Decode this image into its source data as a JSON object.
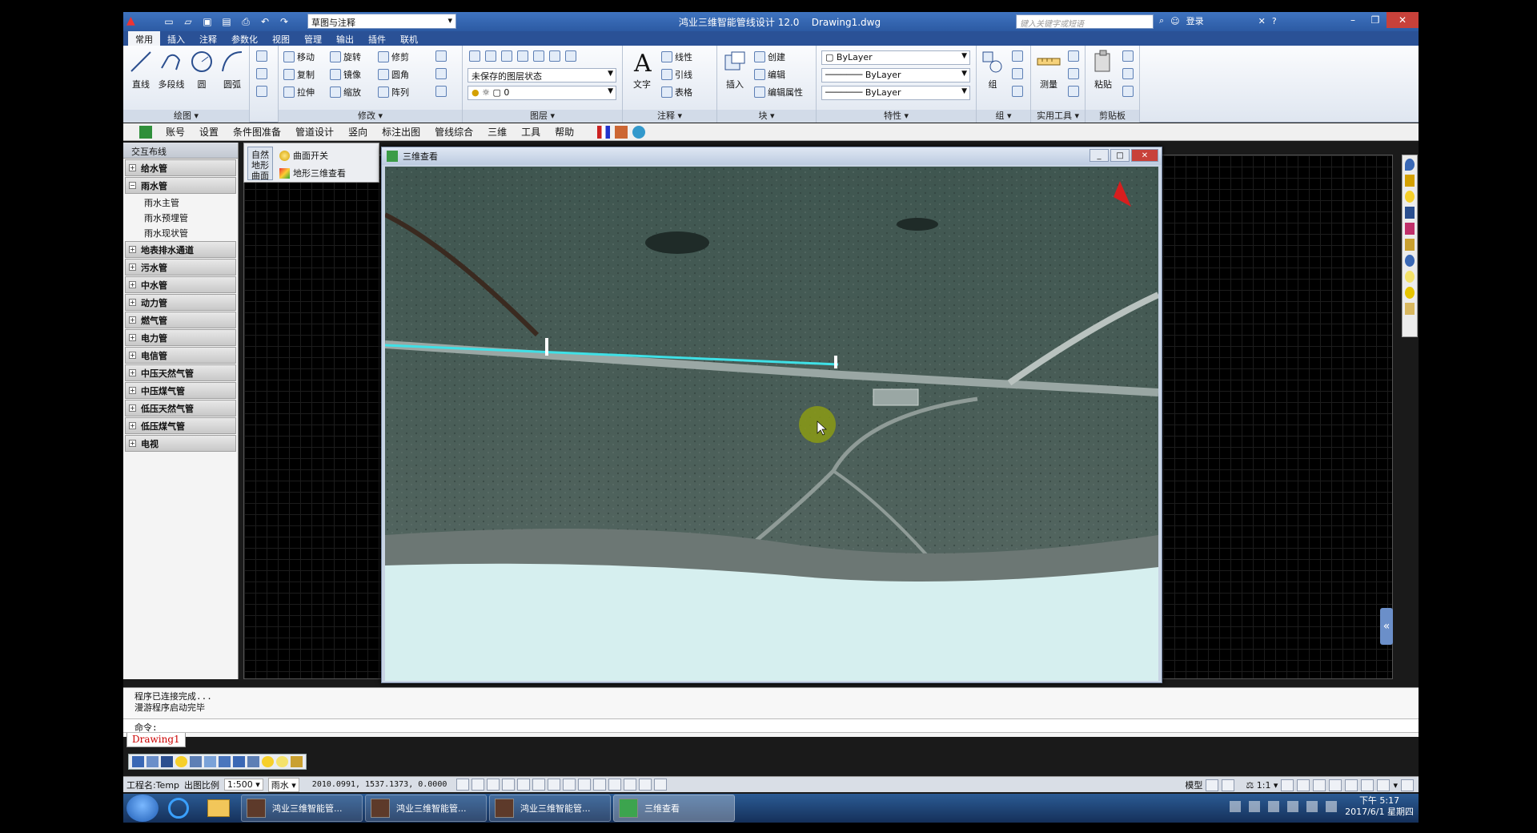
{
  "title_bar": {
    "app_title": "鸿业三维智能管线设计 12.0",
    "doc_name": "Drawing1.dwg",
    "workspace": "草图与注释",
    "search_placeholder": "键入关键字或短语",
    "login": "登录"
  },
  "ribbon_tabs": [
    "常用",
    "插入",
    "注释",
    "参数化",
    "视图",
    "管理",
    "输出",
    "插件",
    "联机"
  ],
  "ribbon": {
    "draw": {
      "title": "绘图",
      "line": "直线",
      "polyline": "多段线",
      "circle": "圆",
      "arc": "圆弧"
    },
    "modify": {
      "title": "修改",
      "move": "移动",
      "rotate": "旋转",
      "trim": "修剪",
      "copy": "复制",
      "mirror": "镜像",
      "fillet": "圆角",
      "stretch": "拉伸",
      "scale": "缩放",
      "array": "阵列"
    },
    "layers": {
      "title": "图层",
      "layer_state": "未保存的图层状态",
      "current_layer": "0"
    },
    "annotation": {
      "title": "注释",
      "text": "文字",
      "linear": "线性",
      "leader": "引线",
      "table": "表格"
    },
    "block": {
      "title": "块",
      "insert": "插入",
      "create": "创建",
      "edit": "编辑",
      "edit_attr": "编辑属性"
    },
    "properties": {
      "title": "特性",
      "color": "ByLayer",
      "linetype": "ByLayer",
      "lineweight": "ByLayer"
    },
    "groups": {
      "title": "组",
      "group": "组"
    },
    "utilities": {
      "title": "实用工具",
      "measure": "测量"
    },
    "clipboard": {
      "title": "剪贴板",
      "paste": "粘贴"
    }
  },
  "plugin_menu": [
    "账号",
    "设置",
    "条件图准备",
    "管道设计",
    "竖向",
    "标注出图",
    "管线综合",
    "三维",
    "工具",
    "帮助"
  ],
  "palette": {
    "title": "交互布线",
    "groups": [
      {
        "label": "给水管",
        "expanded": false,
        "children": []
      },
      {
        "label": "雨水管",
        "expanded": true,
        "children": [
          "雨水主管",
          "雨水预埋管",
          "雨水现状管"
        ]
      },
      {
        "label": "地表排水通道",
        "expanded": false,
        "children": []
      },
      {
        "label": "污水管",
        "expanded": false,
        "children": []
      },
      {
        "label": "中水管",
        "expanded": false,
        "children": []
      },
      {
        "label": "动力管",
        "expanded": false,
        "children": []
      },
      {
        "label": "燃气管",
        "expanded": false,
        "children": []
      },
      {
        "label": "电力管",
        "expanded": false,
        "children": []
      },
      {
        "label": "电信管",
        "expanded": false,
        "children": []
      },
      {
        "label": "中压天然气管",
        "expanded": false,
        "children": []
      },
      {
        "label": "中压煤气管",
        "expanded": false,
        "children": []
      },
      {
        "label": "低压天然气管",
        "expanded": false,
        "children": []
      },
      {
        "label": "低压煤气管",
        "expanded": false,
        "children": []
      },
      {
        "label": "电视",
        "expanded": false,
        "children": []
      }
    ]
  },
  "sub_toolbar": {
    "big_button": "自然地形曲面",
    "surface_toggle": "曲面开关",
    "terrain_3d": "地形三维查看"
  },
  "viewer": {
    "title": "三维查看"
  },
  "command": {
    "history": [
      "程序已连接完成...",
      "漫游程序启动完毕"
    ],
    "prompt": "命令:",
    "doc_tab": "Drawing1"
  },
  "status": {
    "project": "工程名:Temp",
    "scale_label": "出图比例",
    "scale_value": "1:500",
    "pipe_type": "雨水",
    "coords": "2010.0991, 1537.1373, 0.0000",
    "model": "模型",
    "anno_scale": "1:1"
  },
  "taskbar": {
    "items": [
      "鸿业三维智能管...",
      "鸿业三维智能管...",
      "鸿业三维智能管...",
      "三维查看"
    ],
    "time": "下午 5:17",
    "date": "2017/6/1 星期四"
  }
}
